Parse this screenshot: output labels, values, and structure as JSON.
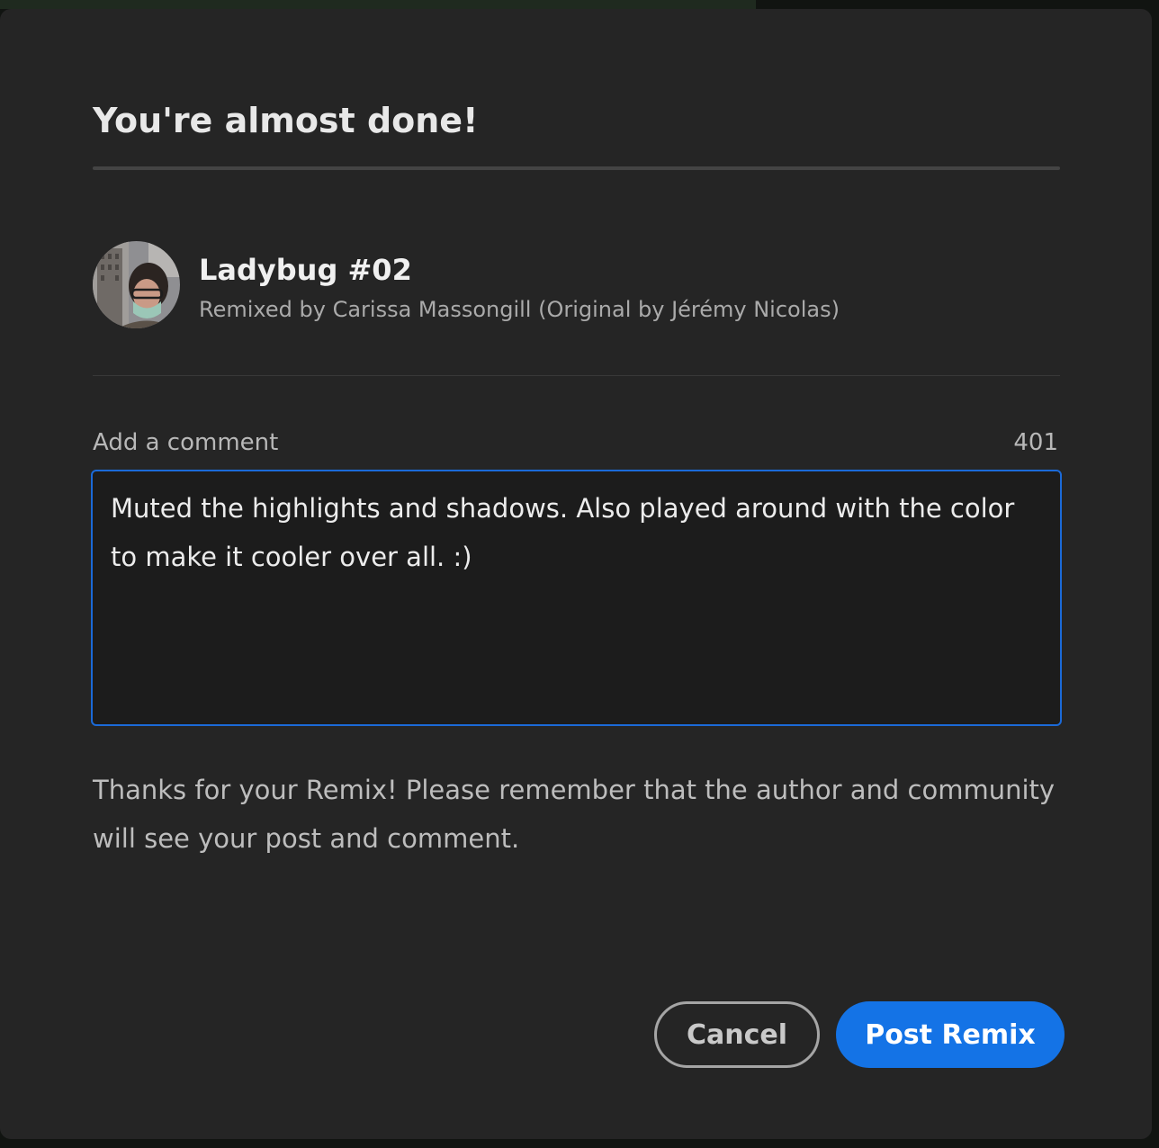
{
  "dialog": {
    "title": "You're almost done!"
  },
  "project": {
    "name": "Ladybug #02",
    "credit": "Remixed by Carissa Massongill (Original by Jérémy Nicolas)",
    "avatar_alt": "Carissa Massongill"
  },
  "comment": {
    "label": "Add a comment",
    "remaining_chars": "401",
    "value": "Muted the highlights and shadows. Also played around with the color to make it cooler over all. :)"
  },
  "notice": "Thanks for your Remix! Please remember that the author and community will see your post and comment.",
  "actions": {
    "cancel_label": "Cancel",
    "post_label": "Post Remix"
  },
  "colors": {
    "dialog_bg": "#252525",
    "accent": "#1473e6",
    "focus_border": "#1b6ad8"
  }
}
